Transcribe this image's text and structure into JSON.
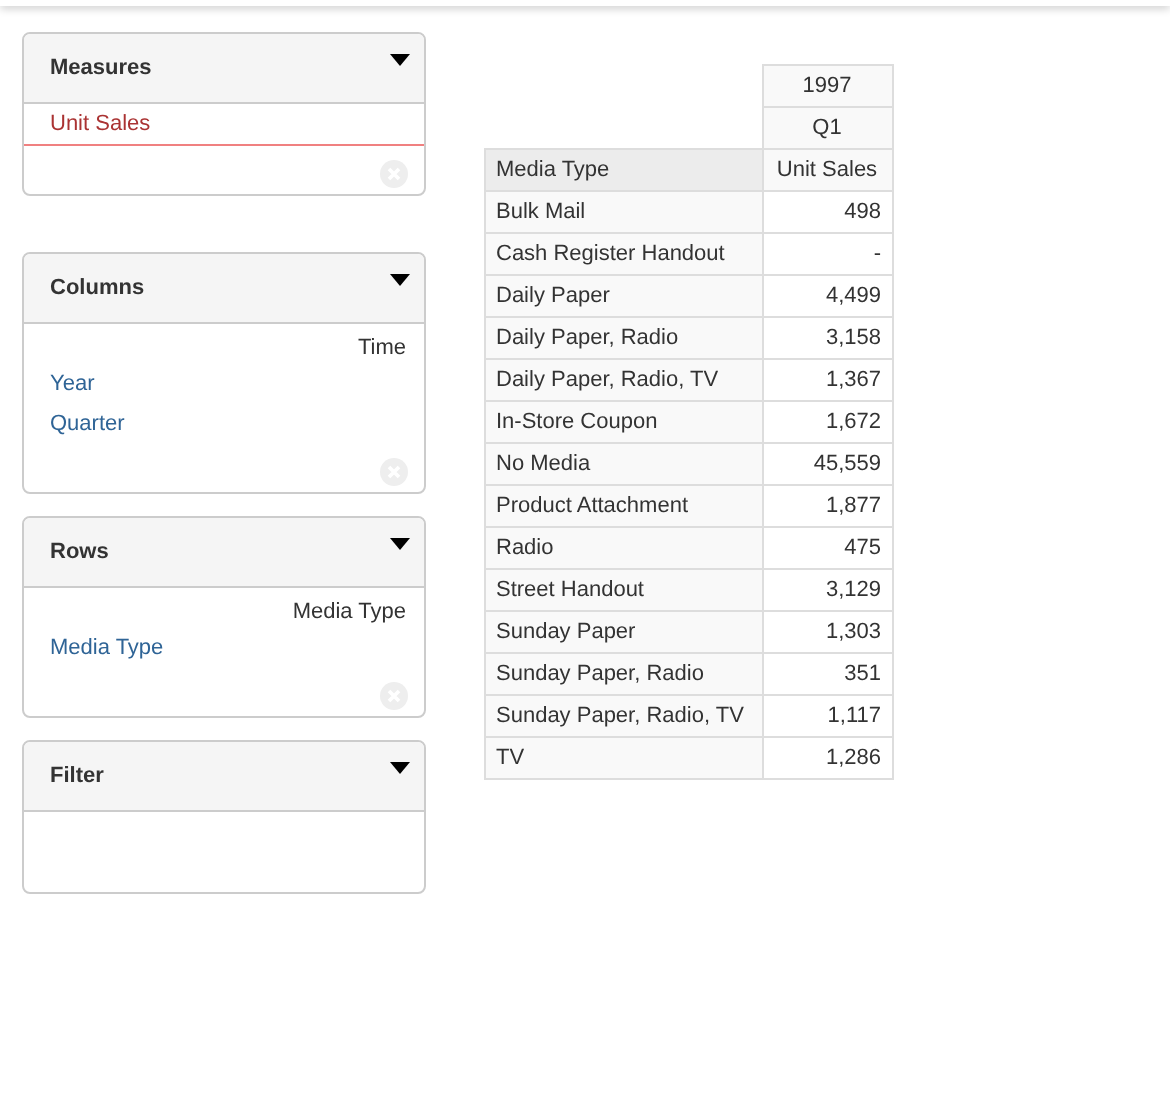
{
  "panels": [
    {
      "title": "Measures",
      "clearable": true,
      "items": [
        {
          "label": "Unit Sales",
          "kind": "measure"
        }
      ]
    },
    {
      "title": "Columns",
      "clearable": true,
      "hierarchy": "Time",
      "items": [
        {
          "label": "Year",
          "kind": "level"
        },
        {
          "label": "Quarter",
          "kind": "level"
        }
      ]
    },
    {
      "title": "Rows",
      "clearable": true,
      "hierarchy": "Media Type",
      "items": [
        {
          "label": "Media Type",
          "kind": "level"
        }
      ]
    },
    {
      "title": "Filter",
      "clearable": false
    }
  ],
  "table": {
    "column_headers": [
      "1997",
      "Q1"
    ],
    "row_header": "Media Type",
    "measure": "Unit Sales",
    "rows": [
      {
        "label": "Bulk Mail",
        "value": "498"
      },
      {
        "label": "Cash Register Handout",
        "value": "-"
      },
      {
        "label": "Daily Paper",
        "value": "4,499"
      },
      {
        "label": "Daily Paper, Radio",
        "value": "3,158"
      },
      {
        "label": "Daily Paper, Radio, TV",
        "value": "1,367"
      },
      {
        "label": "In-Store Coupon",
        "value": "1,672"
      },
      {
        "label": "No Media",
        "value": "45,559"
      },
      {
        "label": "Product Attachment",
        "value": "1,877"
      },
      {
        "label": "Radio",
        "value": "475"
      },
      {
        "label": "Street Handout",
        "value": "3,129"
      },
      {
        "label": "Sunday Paper",
        "value": "1,303"
      },
      {
        "label": "Sunday Paper, Radio",
        "value": "351"
      },
      {
        "label": "Sunday Paper, Radio, TV",
        "value": "1,117"
      },
      {
        "label": "TV",
        "value": "1,286"
      }
    ]
  }
}
